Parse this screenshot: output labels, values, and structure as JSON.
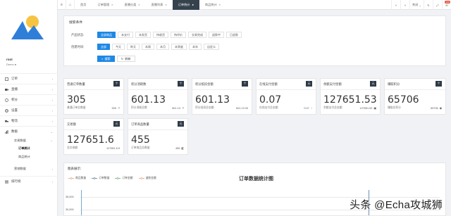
{
  "app": {
    "user_name": "root",
    "user_status": "Demo ●"
  },
  "sidebar": {
    "items": [
      {
        "label": "订单",
        "icon": "order-icon"
      },
      {
        "label": "直播",
        "icon": "video-icon"
      },
      {
        "label": "积分",
        "icon": "coin-icon"
      },
      {
        "label": "设置",
        "icon": "gear-icon"
      },
      {
        "label": "物流",
        "icon": "truck-icon"
      },
      {
        "label": "数据",
        "icon": "data-icon"
      }
    ],
    "sub_group": "交易数据",
    "sub_items": [
      "订单统计",
      "商品统计"
    ],
    "sub_group2": "营销数据",
    "bottom_item": "排行榜"
  },
  "topbar": {
    "tabs": [
      "首页",
      "订单管理",
      "直播分类",
      "直播列表",
      "订单统计",
      "商品统计"
    ],
    "active_tab": 4,
    "fullscreen_label": "关闭",
    "badge_count": "100"
  },
  "search": {
    "title": "搜索条件",
    "status_label": "产品状态:",
    "status_options": [
      "全部商品",
      "未支付",
      "未发货",
      "待收货",
      "待评价",
      "交易完成",
      "退款中",
      "已退款"
    ],
    "time_label": "创建时间:",
    "time_options": [
      "全部",
      "今天",
      "昨天",
      "本周",
      "本月",
      "本季度",
      "本年",
      "自定义"
    ],
    "search_button": "搜索",
    "reset_button": "刷新"
  },
  "cards": [
    {
      "title": "普通订单数量",
      "tag": "个",
      "value": "305",
      "sub": "普通订单总数量",
      "num": "305"
    },
    {
      "title": "积分消耗数",
      "tag": "个",
      "value": "601.13",
      "sub": "积分消耗总数",
      "num": "601.13"
    },
    {
      "title": "积分抵扣金额",
      "tag": "个",
      "value": "601.13",
      "sub": "积分抵扣总金额",
      "num": "601.13 00"
    },
    {
      "title": "在线支付金额",
      "tag": "元",
      "value": "0.07",
      "sub": "在线支付总金额",
      "num": "0.07"
    },
    {
      "title": "余额支付金额",
      "tag": "元",
      "value": "127651.53",
      "sub": "余额支付总金额",
      "num": "127651.53"
    },
    {
      "title": "赚取积分",
      "tag": "个",
      "value": "65706",
      "sub": "赚取总积分",
      "num": "65706"
    },
    {
      "title": "交易额",
      "tag": "元",
      "value": "127651.6",
      "sub": "总交易额",
      "num": "127651.6 ¥"
    },
    {
      "title": "订单商品数量",
      "tag": "元",
      "value": "455",
      "sub": "订单商品总数量",
      "num": "455"
    }
  ],
  "chart": {
    "panel_title": "图表展示:",
    "title": "订单数据统计图",
    "legend": [
      {
        "name": "商品数量",
        "color": "#e8a17a"
      },
      {
        "name": "订单数量",
        "color": "#5b7c99"
      },
      {
        "name": "订单金额",
        "color": "#6aa87c"
      },
      {
        "name": "退款金额",
        "color": "#e8a17a"
      }
    ],
    "yticks": [
      "35,000",
      "30,000"
    ]
  },
  "chart_data": {
    "type": "line",
    "title": "订单数据统计图",
    "series": [
      {
        "name": "商品数量",
        "values": []
      },
      {
        "name": "订单数量",
        "values": []
      },
      {
        "name": "订单金额",
        "values": []
      },
      {
        "name": "退款金额",
        "values": []
      }
    ],
    "yticks": [
      35000,
      30000
    ],
    "legend_position": "top-left"
  },
  "watermark": "头条 @Echa攻城狮"
}
